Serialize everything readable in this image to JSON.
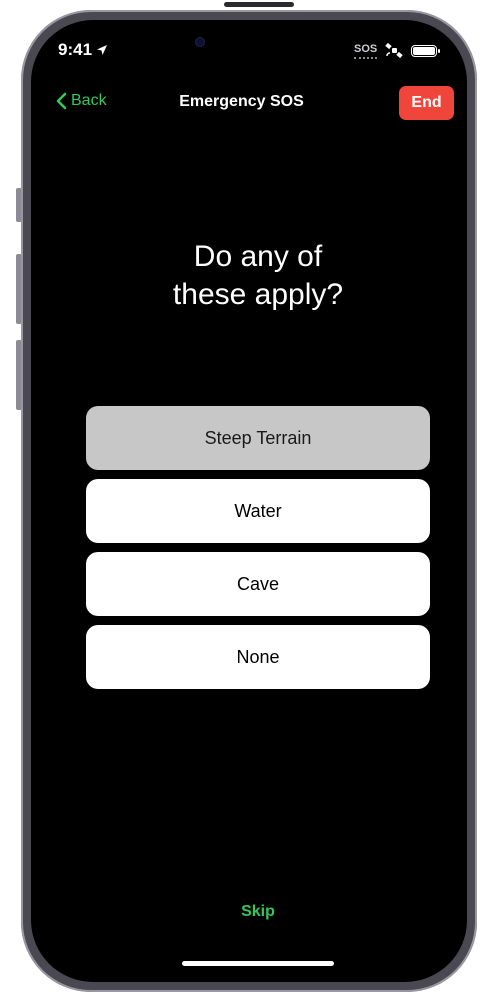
{
  "status": {
    "time": "9:41",
    "sos_label": "SOS"
  },
  "nav": {
    "back_label": "Back",
    "title": "Emergency SOS",
    "end_label": "End"
  },
  "question": {
    "line1": "Do any of",
    "line2": "these apply?"
  },
  "options": [
    {
      "label": "Steep Terrain",
      "selected": true
    },
    {
      "label": "Water",
      "selected": false
    },
    {
      "label": "Cave",
      "selected": false
    },
    {
      "label": "None",
      "selected": false
    }
  ],
  "footer": {
    "skip_label": "Skip"
  },
  "colors": {
    "accent_green": "#34c759",
    "end_red": "#f0453a",
    "selected_option": "#c7c7c7"
  }
}
